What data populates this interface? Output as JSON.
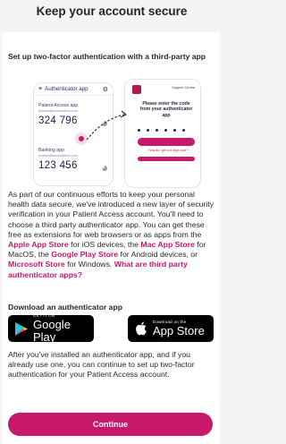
{
  "page_title": "Keep your account secure",
  "heading": "Set up two-factor authentication with a third-party app",
  "illustration": {
    "app_title": "Authenticator app",
    "entries": [
      {
        "label": "Patient Access app",
        "email": "jamesw@emailaddress.com",
        "code": "324 796"
      },
      {
        "label": "Banking app",
        "email": "jamesw@emailaddress.com",
        "code": "123 456"
      }
    ],
    "support_label": "Support Centre",
    "prompt": "Please enter the code from your authenticator app",
    "help_text": "How do I get a 6 digit code?"
  },
  "body": {
    "text_1": "As part of our continuous efforts to keep your personal health data secure, we've introduced a new layer of security verification in your Patient Access account. You'll need to choose a third party authenticator app. You can get these free as extensions for web browsers or as apps from the ",
    "link_apple": "Apple App Store",
    "text_2": " for iOS devices, the ",
    "link_mac": "Mac App Store",
    "text_3": " for MacOS, the ",
    "link_google": "Google Play Store",
    "text_4": " for Android devices, or ",
    "link_microsoft": "Microsoft Store",
    "text_5": " for Windows. ",
    "link_what": "What are third party authenticator apps?"
  },
  "download_heading": "Download an authenticator app",
  "google_play": {
    "small": "GET IT ON",
    "big": "Google Play"
  },
  "app_store": {
    "small": "Download on the",
    "big": "App Store"
  },
  "after_text": "After you've installed an authenticator app, and if you already use one, you can continue to set up two-factor authentication for your Patient Access account.",
  "continue_label": "Continue",
  "colors": {
    "accent": "#c8186a",
    "background": "#f4f4f4",
    "card": "#ffffff"
  }
}
